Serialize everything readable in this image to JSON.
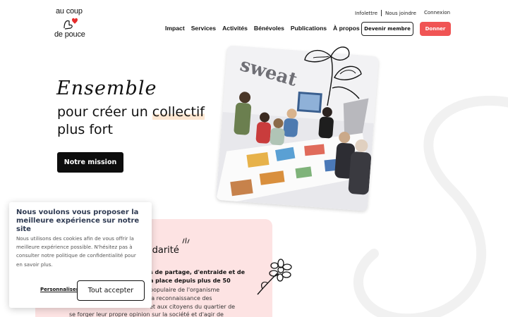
{
  "brand": {
    "logo_top": "au coup",
    "logo_bottom": "de pouce",
    "accent": "#f05454",
    "dark": "#0d0d0d"
  },
  "utility": {
    "link1": "Infolettre",
    "link2": "Nous joindre",
    "login": "Connexion"
  },
  "nav": {
    "items": [
      "Impact",
      "Services",
      "Activités",
      "Bénévoles",
      "Publications",
      "À propos"
    ]
  },
  "buttons": {
    "member": "Devenir membre",
    "donate": "Donner",
    "mission": "Notre mission"
  },
  "hero": {
    "script_title": "Ensemble",
    "line2_pre": "pour créer un ",
    "line2_highlight": "collectif",
    "line3": "plus fort"
  },
  "photo": {
    "alt": "Groupe de personnes autour d'une table de collage",
    "wall_text": "sweat"
  },
  "section": {
    "heading": "idarité",
    "bold1": "s de partage, d'entraide et de",
    "bold2": "a place depuis plus de 50",
    "body1": "populaire de l'organisme",
    "body2": "la reconnaissance des",
    "body3": "et aux citoyens du quartier de",
    "body4": "se forger leur propre opinion sur la société et d'agir de"
  },
  "cookie": {
    "title": "Nous voulons vous proposer la meilleure expérience sur notre site",
    "text_lines": [
      "Nous utilisons des cookies afin de vous offrir la",
      "meilleure expérience possible. N'hésitez pas à",
      "consulter notre politique de confidentialité pour",
      "en savoir plus."
    ],
    "customize": "Personnaliser",
    "accept": "Tout accepter"
  }
}
